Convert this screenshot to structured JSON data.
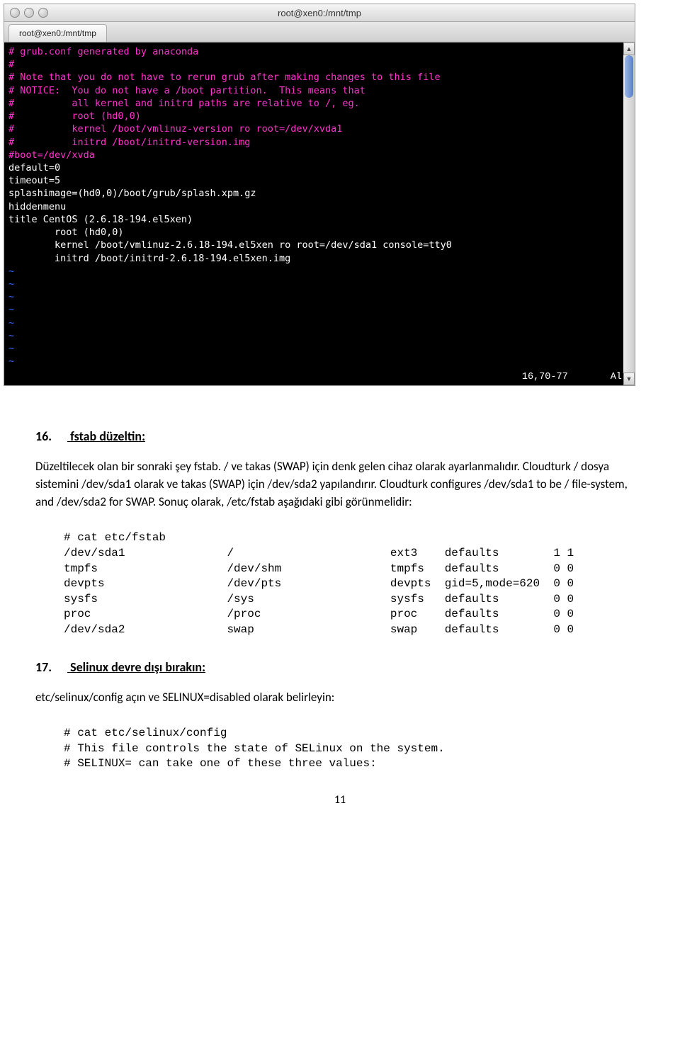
{
  "window": {
    "title": "root@xen0:/mnt/tmp",
    "tab": "root@xen0:/mnt/tmp"
  },
  "terminal": {
    "lines": [
      {
        "cls": "comment",
        "text": "# grub.conf generated by anaconda"
      },
      {
        "cls": "comment",
        "text": "#"
      },
      {
        "cls": "comment",
        "text": "# Note that you do not have to rerun grub after making changes to this file"
      },
      {
        "cls": "comment",
        "text": "# NOTICE:  You do not have a /boot partition.  This means that"
      },
      {
        "cls": "comment",
        "text": "#          all kernel and initrd paths are relative to /, eg."
      },
      {
        "cls": "comment",
        "text": "#          root (hd0,0)"
      },
      {
        "cls": "comment",
        "text": "#          kernel /boot/vmlinuz-version ro root=/dev/xvda1"
      },
      {
        "cls": "comment",
        "text": "#          initrd /boot/initrd-version.img"
      },
      {
        "cls": "comment",
        "text": "#boot=/dev/xvda"
      },
      {
        "cls": "normal",
        "text": "default=0"
      },
      {
        "cls": "normal",
        "text": "timeout=5"
      },
      {
        "cls": "normal",
        "text": "splashimage=(hd0,0)/boot/grub/splash.xpm.gz"
      },
      {
        "cls": "normal",
        "text": "hiddenmenu"
      },
      {
        "cls": "normal",
        "text": "title CentOS (2.6.18-194.el5xen)"
      },
      {
        "cls": "normal",
        "text": "        root (hd0,0)"
      },
      {
        "cls": "normal",
        "text": "        kernel /boot/vmlinuz-2.6.18-194.el5xen ro root=/dev/sda1 console=tty0"
      },
      {
        "cls": "normal",
        "text": "        initrd /boot/initrd-2.6.18-194.el5xen.img"
      },
      {
        "cls": "tilde",
        "text": "~"
      },
      {
        "cls": "tilde",
        "text": "~"
      },
      {
        "cls": "tilde",
        "text": "~"
      },
      {
        "cls": "tilde",
        "text": "~"
      },
      {
        "cls": "tilde",
        "text": "~"
      },
      {
        "cls": "tilde",
        "text": "~"
      },
      {
        "cls": "tilde",
        "text": "~"
      },
      {
        "cls": "tilde",
        "text": "~"
      }
    ],
    "status_pos": "16,70-77",
    "status_pct": "All"
  },
  "section16": {
    "num": "16.",
    "title": "fstab düzeltin:",
    "para": "Düzeltilecek olan bir sonraki şey fstab. / ve takas (SWAP) için denk gelen cihaz olarak ayarlanmalıdır. Cloudturk / dosya sistemini /dev/sda1 olarak ve takas (SWAP) için /dev/sda2 yapılandırır. Cloudturk configures /dev/sda1 to be / file-system, and /dev/sda2 for SWAP. Sonuç olarak, /etc/fstab aşağıdaki gibi görünmelidir:",
    "code": "# cat etc/fstab\n/dev/sda1               /                       ext3    defaults        1 1\ntmpfs                   /dev/shm                tmpfs   defaults        0 0\ndevpts                  /dev/pts                devpts  gid=5,mode=620  0 0\nsysfs                   /sys                    sysfs   defaults        0 0\nproc                    /proc                   proc    defaults        0 0\n/dev/sda2               swap                    swap    defaults        0 0"
  },
  "section17": {
    "num": "17.",
    "title": "Selinux devre dışı bırakın:",
    "para": "etc/selinux/config açın ve SELINUX=disabled olarak belirleyin:",
    "code": "# cat etc/selinux/config\n# This file controls the state of SELinux on the system.\n# SELINUX= can take one of these three values:"
  },
  "page_number": "11"
}
